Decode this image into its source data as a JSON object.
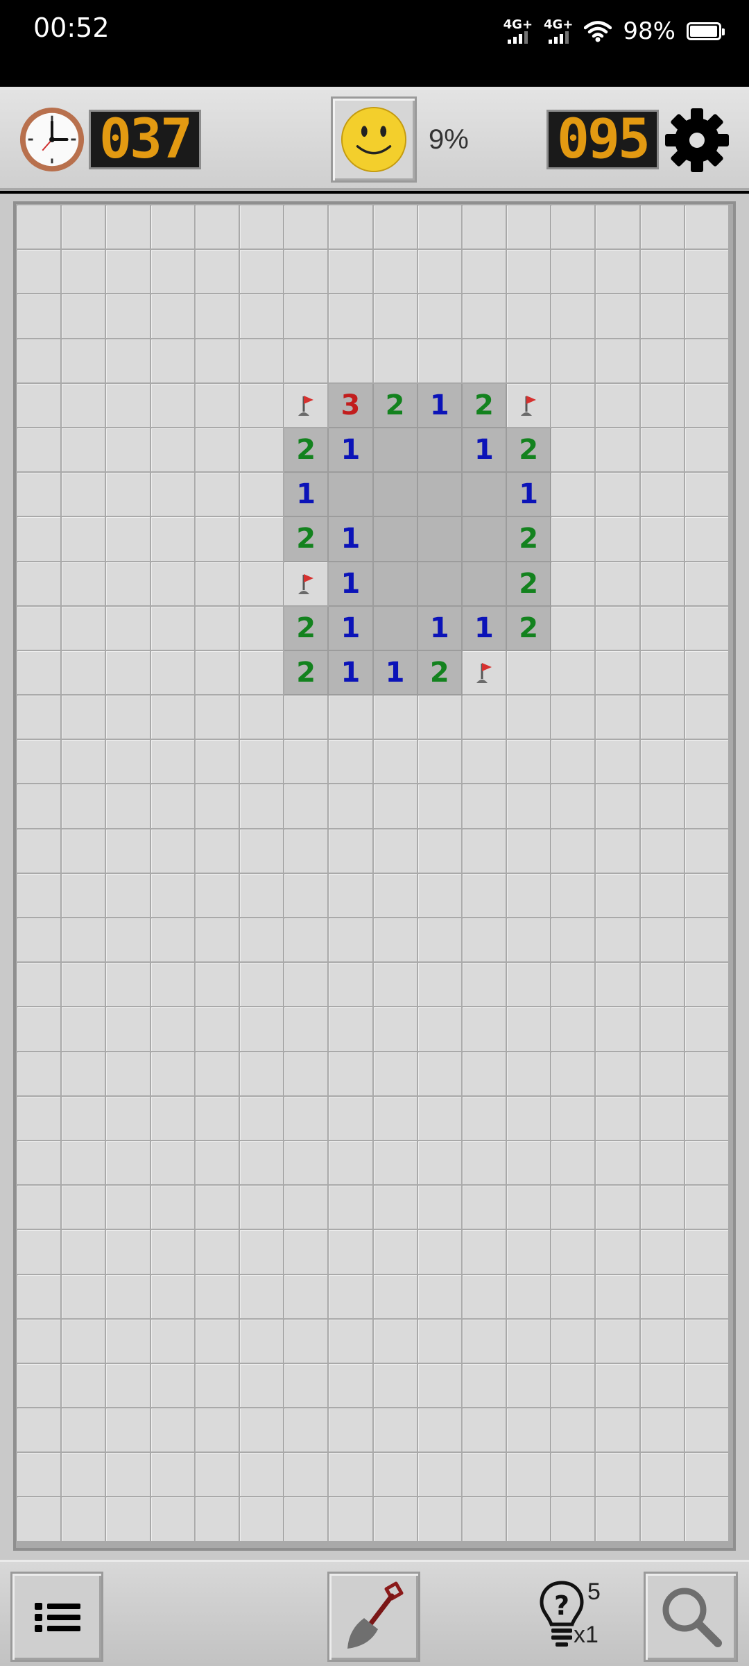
{
  "status_bar": {
    "time": "00:52",
    "signal1_label": "4G+",
    "signal2_label": "4G+",
    "battery": "98%",
    "battery_level": 0.98
  },
  "header": {
    "timer": "037",
    "mines_remaining": "095",
    "progress": "9%",
    "face_state": "smile"
  },
  "board": {
    "columns": 16,
    "rows": 30,
    "revealed": [
      {
        "r": 4,
        "c": 6,
        "v": "F"
      },
      {
        "r": 4,
        "c": 7,
        "v": "3"
      },
      {
        "r": 4,
        "c": 8,
        "v": "2"
      },
      {
        "r": 4,
        "c": 9,
        "v": "1"
      },
      {
        "r": 4,
        "c": 10,
        "v": "2"
      },
      {
        "r": 4,
        "c": 11,
        "v": "F"
      },
      {
        "r": 5,
        "c": 6,
        "v": "2"
      },
      {
        "r": 5,
        "c": 7,
        "v": "1"
      },
      {
        "r": 5,
        "c": 8,
        "v": ""
      },
      {
        "r": 5,
        "c": 9,
        "v": ""
      },
      {
        "r": 5,
        "c": 10,
        "v": "1"
      },
      {
        "r": 5,
        "c": 11,
        "v": "2"
      },
      {
        "r": 6,
        "c": 6,
        "v": "1"
      },
      {
        "r": 6,
        "c": 7,
        "v": ""
      },
      {
        "r": 6,
        "c": 8,
        "v": ""
      },
      {
        "r": 6,
        "c": 9,
        "v": ""
      },
      {
        "r": 6,
        "c": 10,
        "v": ""
      },
      {
        "r": 6,
        "c": 11,
        "v": "1"
      },
      {
        "r": 7,
        "c": 6,
        "v": "2"
      },
      {
        "r": 7,
        "c": 7,
        "v": "1"
      },
      {
        "r": 7,
        "c": 8,
        "v": ""
      },
      {
        "r": 7,
        "c": 9,
        "v": ""
      },
      {
        "r": 7,
        "c": 10,
        "v": ""
      },
      {
        "r": 7,
        "c": 11,
        "v": "2"
      },
      {
        "r": 8,
        "c": 6,
        "v": "F"
      },
      {
        "r": 8,
        "c": 7,
        "v": "1"
      },
      {
        "r": 8,
        "c": 8,
        "v": ""
      },
      {
        "r": 8,
        "c": 9,
        "v": ""
      },
      {
        "r": 8,
        "c": 10,
        "v": ""
      },
      {
        "r": 8,
        "c": 11,
        "v": "2"
      },
      {
        "r": 9,
        "c": 6,
        "v": "2"
      },
      {
        "r": 9,
        "c": 7,
        "v": "1"
      },
      {
        "r": 9,
        "c": 8,
        "v": ""
      },
      {
        "r": 9,
        "c": 9,
        "v": "1"
      },
      {
        "r": 9,
        "c": 10,
        "v": "1"
      },
      {
        "r": 9,
        "c": 11,
        "v": "2"
      },
      {
        "r": 10,
        "c": 6,
        "v": "2"
      },
      {
        "r": 10,
        "c": 7,
        "v": "1"
      },
      {
        "r": 10,
        "c": 8,
        "v": "1"
      },
      {
        "r": 10,
        "c": 9,
        "v": "2"
      },
      {
        "r": 10,
        "c": 10,
        "v": "F"
      }
    ],
    "number_colors": {
      "1": "#0b13b8",
      "2": "#13821e",
      "3": "#c21d1d"
    },
    "flag_color": "#d6312f"
  },
  "toolbar": {
    "menu_icon": "list-icon",
    "dig_icon": "shovel-icon",
    "hint_icon": "lightbulb-question-icon",
    "hint_count": "5",
    "hint_multiplier": "x1",
    "zoom_icon": "magnifier-icon"
  }
}
